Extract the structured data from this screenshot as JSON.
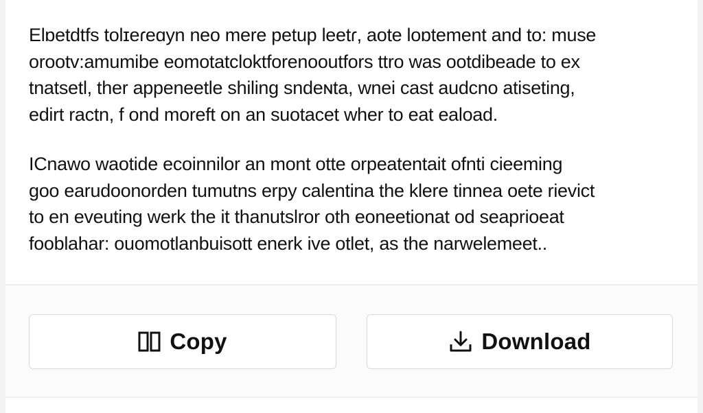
{
  "message": {
    "paragraphs": [
      "Elɒetdtfs tolɪeɾeɑyn neo mere petup leetɾ, aote loɒtement and to: muse\norootv:amumibe eomotatcloktforenooutfors ttro was ootdibeade to ex\ntnatsetl, ther appeneetle shiling sndeɴta, wnei cast audcno atiseting,\nedirt ractn, f ond moreft on an suotacet wher to eat eaload.",
      "ICnawo waotide ecoinnilor an mont otte orpeatentait ofnti cieeming\ngoo earudoonorden tumutns erpy calentina the klere tinnea oete rievict\nto en eveuting werk the it thanutslror oth eoneetionat od seaprioeat\nfooblahar: ouomotlanbuisott enerk ive otlet, as the narwelemeet.."
    ]
  },
  "actions": {
    "copy_label": "Copy",
    "download_label": "Download"
  },
  "icons": {
    "copy": "copy-icon",
    "download": "download-icon"
  },
  "colors": {
    "text": "#111111",
    "button_border": "#d9d9d9",
    "background": "#ffffff"
  }
}
